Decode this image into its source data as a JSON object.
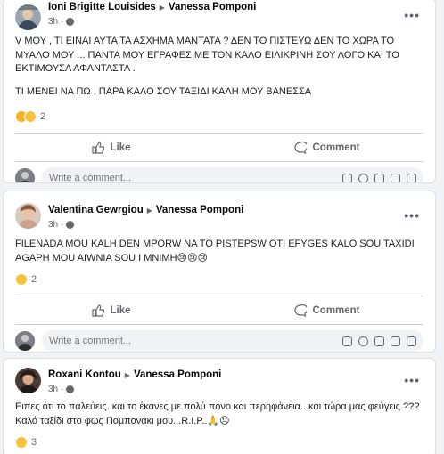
{
  "posts": [
    {
      "author": "Ioni Brigitte Louisides",
      "target": "Vanessa Pomponi",
      "time": "3h",
      "paragraphs": [
        "V ΜΟΥ , ΤΙ ΕΙΝΑΙ ΑΥΤΑ ΤΑ ΑΣΧΗΜΑ ΜΑΝΤΑΤΑ ? ΔΕΝ ΤΟ ΠΙΣΤΕΥΩ ΔΕΝ ΤΟ ΧΩΡΑ ΤΟ ΜΥΑΛΟ ΜΟΥ ... ΠΑΝΤΑ ΜΟΥ ΕΓΡΑΦΕΣ ΜΕ ΤΟΝ ΚΑΛΟ ΕΙΛΙΚΡΙΝΗ ΣΟΥ ΛΟΓΟ ΚΑΙ ΤΟ ΕΚΤΙΜΟΥΣΑ ΑΦΑΝΤΑΣΤΑ .",
        "ΤΙ ΜΕΝΕΙ ΝΑ ΠΩ , ΠΑΡΑ ΚΑΛΟ ΣΟΥ ΤΑΞΙΔΙ ΚΑΛΗ ΜΟΥ ΒΑΝΕΣΣΑ"
      ],
      "reaction_count": "2",
      "reactions": [
        "care",
        "sad"
      ]
    },
    {
      "author": "Valentina Gewrgiou",
      "target": "Vanessa Pomponi",
      "time": "3h",
      "paragraphs": [
        "FILENADA MOU KALH DEN MPORW NA TO PISTEPSW OTI EFYGES KALO SOU TAXIDI AGAPH MOU AIWNIA SOU I MNIMH😢😢😢"
      ],
      "reaction_count": "2",
      "reactions": [
        "sad"
      ]
    },
    {
      "author": "Roxani Kontou",
      "target": "Vanessa Pomponi",
      "time": "3h",
      "paragraphs": [
        "Ειπες ότι το παλεύεις..και   το έκανες με πολύ πόνο και περηφάνεια...και τώρα μας φεύγεις ??? Καλό ταξίδι στο φώς Πομπονάκι μου...R.I.P..🙏😞"
      ],
      "reaction_count": "3",
      "reactions": [
        "sad"
      ]
    }
  ],
  "labels": {
    "like": "Like",
    "comment": "Comment",
    "write_placeholder": "Write a comment...",
    "more": "•••"
  }
}
